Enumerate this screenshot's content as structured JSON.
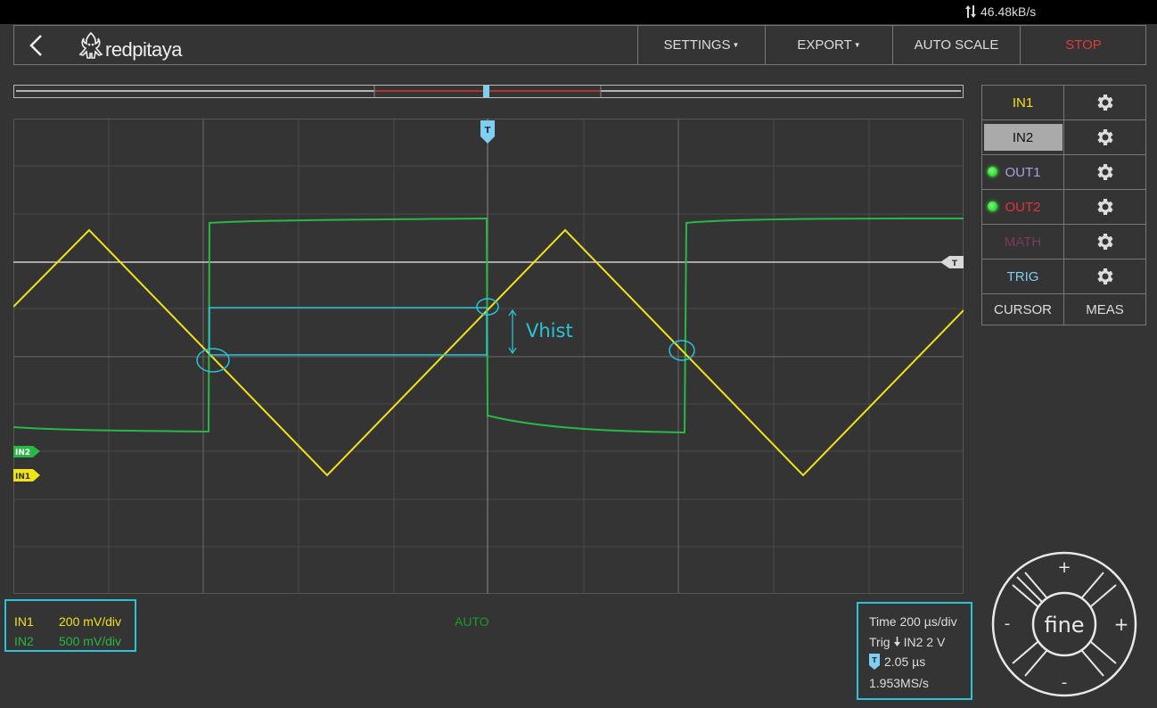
{
  "status": {
    "rate": "46.48kB/s"
  },
  "header": {
    "brand": "redpitaya",
    "settings": "SETTINGS",
    "export": "EXPORT",
    "autoscale": "AUTO SCALE",
    "stop": "STOP"
  },
  "colors": {
    "in1": "#f0e21a",
    "in2": "#27b845",
    "accent": "#2bc3d6",
    "stop": "#e33a3a",
    "out1": "#a8a0e0",
    "out2": "#e8323a",
    "math": "#7a3a5a",
    "trig": "#7fd0f0"
  },
  "sidebar": {
    "in1": "IN1",
    "in2": "IN2",
    "out1": "OUT1",
    "out2": "OUT2",
    "math": "MATH",
    "trig": "TRIG",
    "cursor": "CURSOR",
    "meas": "MEAS"
  },
  "plot": {
    "trigger_marker": "T",
    "in2_marker": "IN2",
    "in1_marker": "IN1",
    "annotation": "Vhist"
  },
  "channels": {
    "in1_label": "IN1",
    "in1_scale": "200 mV/div",
    "in2_label": "IN2",
    "in2_scale": "500 mV/div"
  },
  "mode": "AUTO",
  "timing": {
    "time": "Time 200 µs/div",
    "trig_prefix": "Trig",
    "trig_value": "IN2 2 V",
    "offset": "2.05 µs",
    "sample_rate": "1.953MS/s"
  },
  "jog": {
    "center": "fine",
    "plus": "+",
    "minus": "-"
  }
}
